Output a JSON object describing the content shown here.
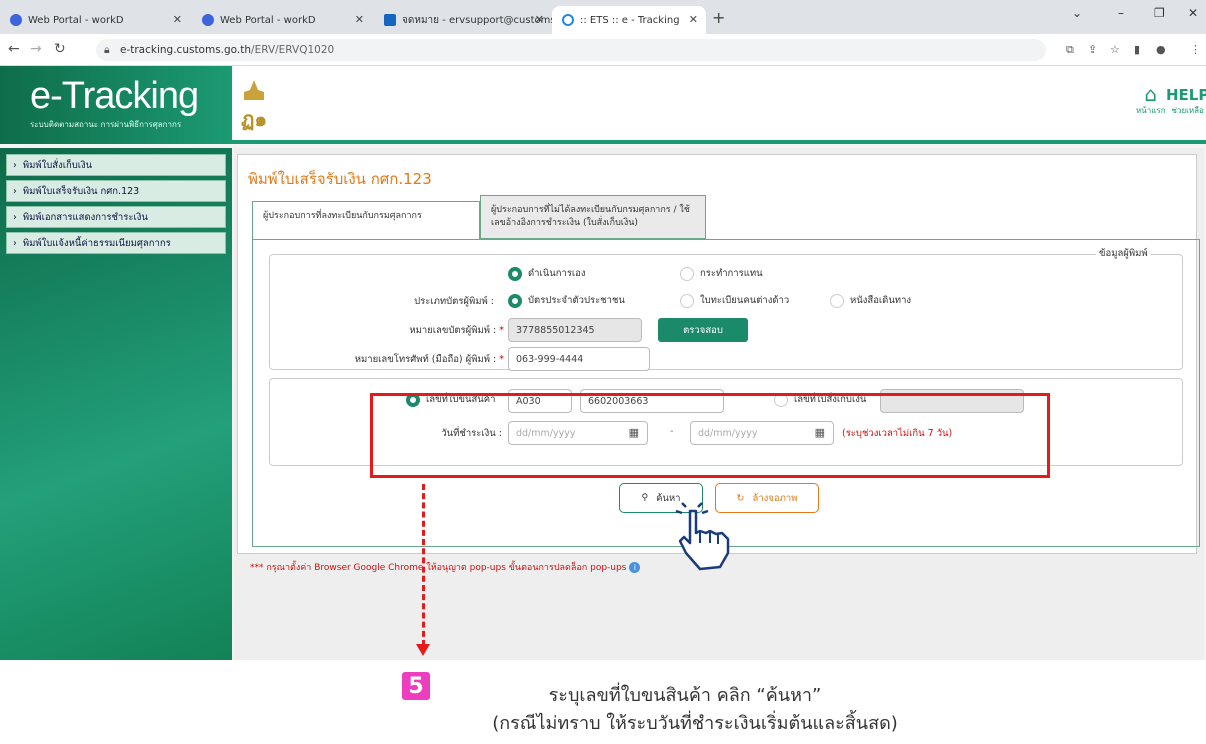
{
  "browser": {
    "tabs": [
      {
        "title": "Web Portal - workD"
      },
      {
        "title": "Web Portal - workD"
      },
      {
        "title": "จดหมาย - ervsupport@customs.g"
      },
      {
        "title": ":: ETS :: e - Tracking"
      }
    ],
    "url_host": "e-tracking.customs.go.th",
    "url_path": "/ERV/ERVQ1020"
  },
  "header": {
    "logo": "e-Tracking",
    "logo_subtitle": "ระบบติดตามสถานะ การผ่านพิธีการศุลกากร",
    "home_label": "หน้าแรก",
    "help_title": "HELP",
    "help_label": "ช่วยเหลือ"
  },
  "sidebar": {
    "items": [
      {
        "label": "พิมพ์ใบสั่งเก็บเงิน"
      },
      {
        "label": "พิมพ์ใบเสร็จรับเงิน กศก.123"
      },
      {
        "label": "พิมพ์เอกสารแสดงการชำระเงิน"
      },
      {
        "label": "พิมพ์ใบแจ้งหนี้ค่าธรรมเนียมศุลกากร"
      }
    ]
  },
  "main": {
    "title": "พิมพ์ใบเสร็จรับเงิน กศก.123",
    "tabs": [
      {
        "label": "ผู้ประกอบการที่ลงทะเบียนกับกรมศุลกากร"
      },
      {
        "label": "ผู้ประกอบการที่ไม่ได้ลงทะเบียนกับกรมศุลกากร / ใช้เลขอ้างอิงการชำระเงิน (ใบสั่งเก็บเงิน)"
      }
    ],
    "printer_section": {
      "legend": "ข้อมูลผู้พิมพ์",
      "action_options": [
        {
          "label": "ดำเนินการเอง",
          "selected": true
        },
        {
          "label": "กระทำการแทน",
          "selected": false
        }
      ],
      "card_type_label": "ประเภทบัตรผู้พิมพ์ :",
      "card_type_options": [
        {
          "label": "บัตรประจำตัวประชาชน",
          "selected": true
        },
        {
          "label": "ใบทะเบียนคนต่างด้าว",
          "selected": false
        },
        {
          "label": "หนังสือเดินทาง",
          "selected": false
        }
      ],
      "card_no_label": "หมายเลขบัตรผู้พิมพ์ :",
      "card_no_value": "3778855012345",
      "verify_button": "ตรวจสอบ",
      "phone_label": "หมายเลขโทรศัพท์ (มือถือ) ผู้พิมพ์ :",
      "phone_value": "063-999-4444"
    },
    "search_section": {
      "declaration_label": "เลขที่ใบขนสินค้า",
      "declaration_selected": true,
      "declaration_part1": "A030",
      "declaration_part2": "6602003663",
      "bill_label": "เลขที่ใบสั่งเก็บเงิน",
      "bill_selected": false,
      "payment_date_label": "วันที่ชำระเงิน :",
      "date_placeholder": "dd/mm/yyyy",
      "date_separator": "-",
      "date_note": "(ระบุช่วงเวลาไม่เกิน 7 วัน)"
    },
    "search_button": "ค้นหา",
    "clear_button": "ล้างจอภาพ",
    "note": "*** กรุณาตั้งค่า Browser Google Chrome ให้อนุญาต pop-ups ขั้นตอนการปลดล็อก pop-ups"
  },
  "annotation": {
    "step": "5",
    "line1": "ระบุเลขที่ใบขนสินค้า คลิก “ค้นหา”",
    "line2": "(กรณีไม่ทราบ ให้ระบวันที่ชำระเงินเริ่มต้นและสิ้นสด)",
    "highlight_color": "#e51b1b",
    "step_color": "#ee3ec0"
  },
  "colors": {
    "brand_green": "#1b9a73",
    "title_orange": "#e07a19"
  }
}
